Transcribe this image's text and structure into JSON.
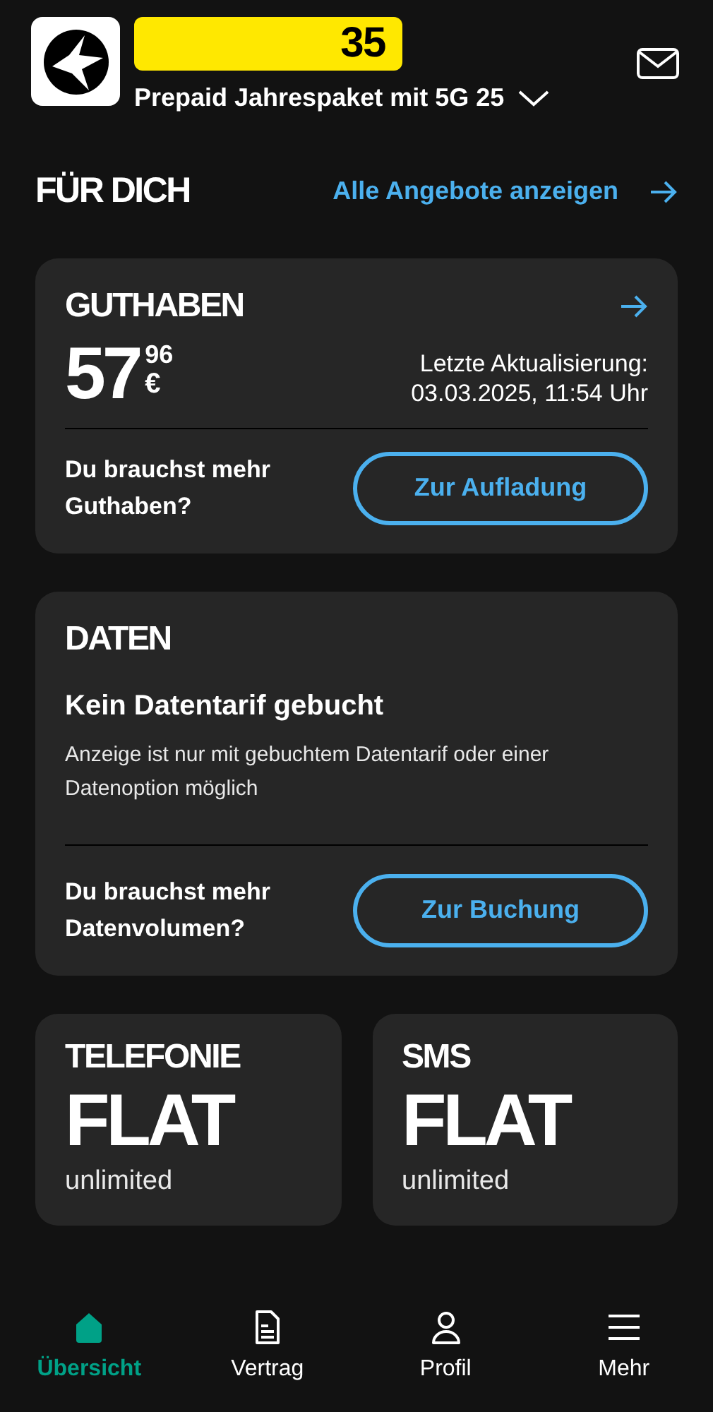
{
  "header": {
    "badge": "35",
    "tariff": "Prepaid Jahrespaket mit 5G 25"
  },
  "section": {
    "title": "FÜR DICH",
    "link": "Alle Angebote anzeigen"
  },
  "balance": {
    "title": "GUTHABEN",
    "euros": "57",
    "cents": "96",
    "currency": "€",
    "updated_label": "Letzte Aktualisierung:",
    "updated_value": "03.03.2025, 11:54 Uhr",
    "prompt": "Du brauchst mehr Guthaben?",
    "button": "Zur Aufladung"
  },
  "data": {
    "title": "DATEN",
    "headline": "Kein Datentarif gebucht",
    "note": "Anzeige ist nur mit gebuchtem Datentarif oder einer Datenoption möglich",
    "prompt": "Du brauchst mehr Datenvolumen?",
    "button": "Zur Buchung"
  },
  "tiles": [
    {
      "title": "TELEFONIE",
      "value": "FLAT",
      "sub": "unlimited"
    },
    {
      "title": "SMS",
      "value": "FLAT",
      "sub": "unlimited"
    }
  ],
  "nav": [
    {
      "label": "Übersicht",
      "selected": true
    },
    {
      "label": "Vertrag",
      "selected": false
    },
    {
      "label": "Profil",
      "selected": false
    },
    {
      "label": "Mehr",
      "selected": false
    }
  ]
}
